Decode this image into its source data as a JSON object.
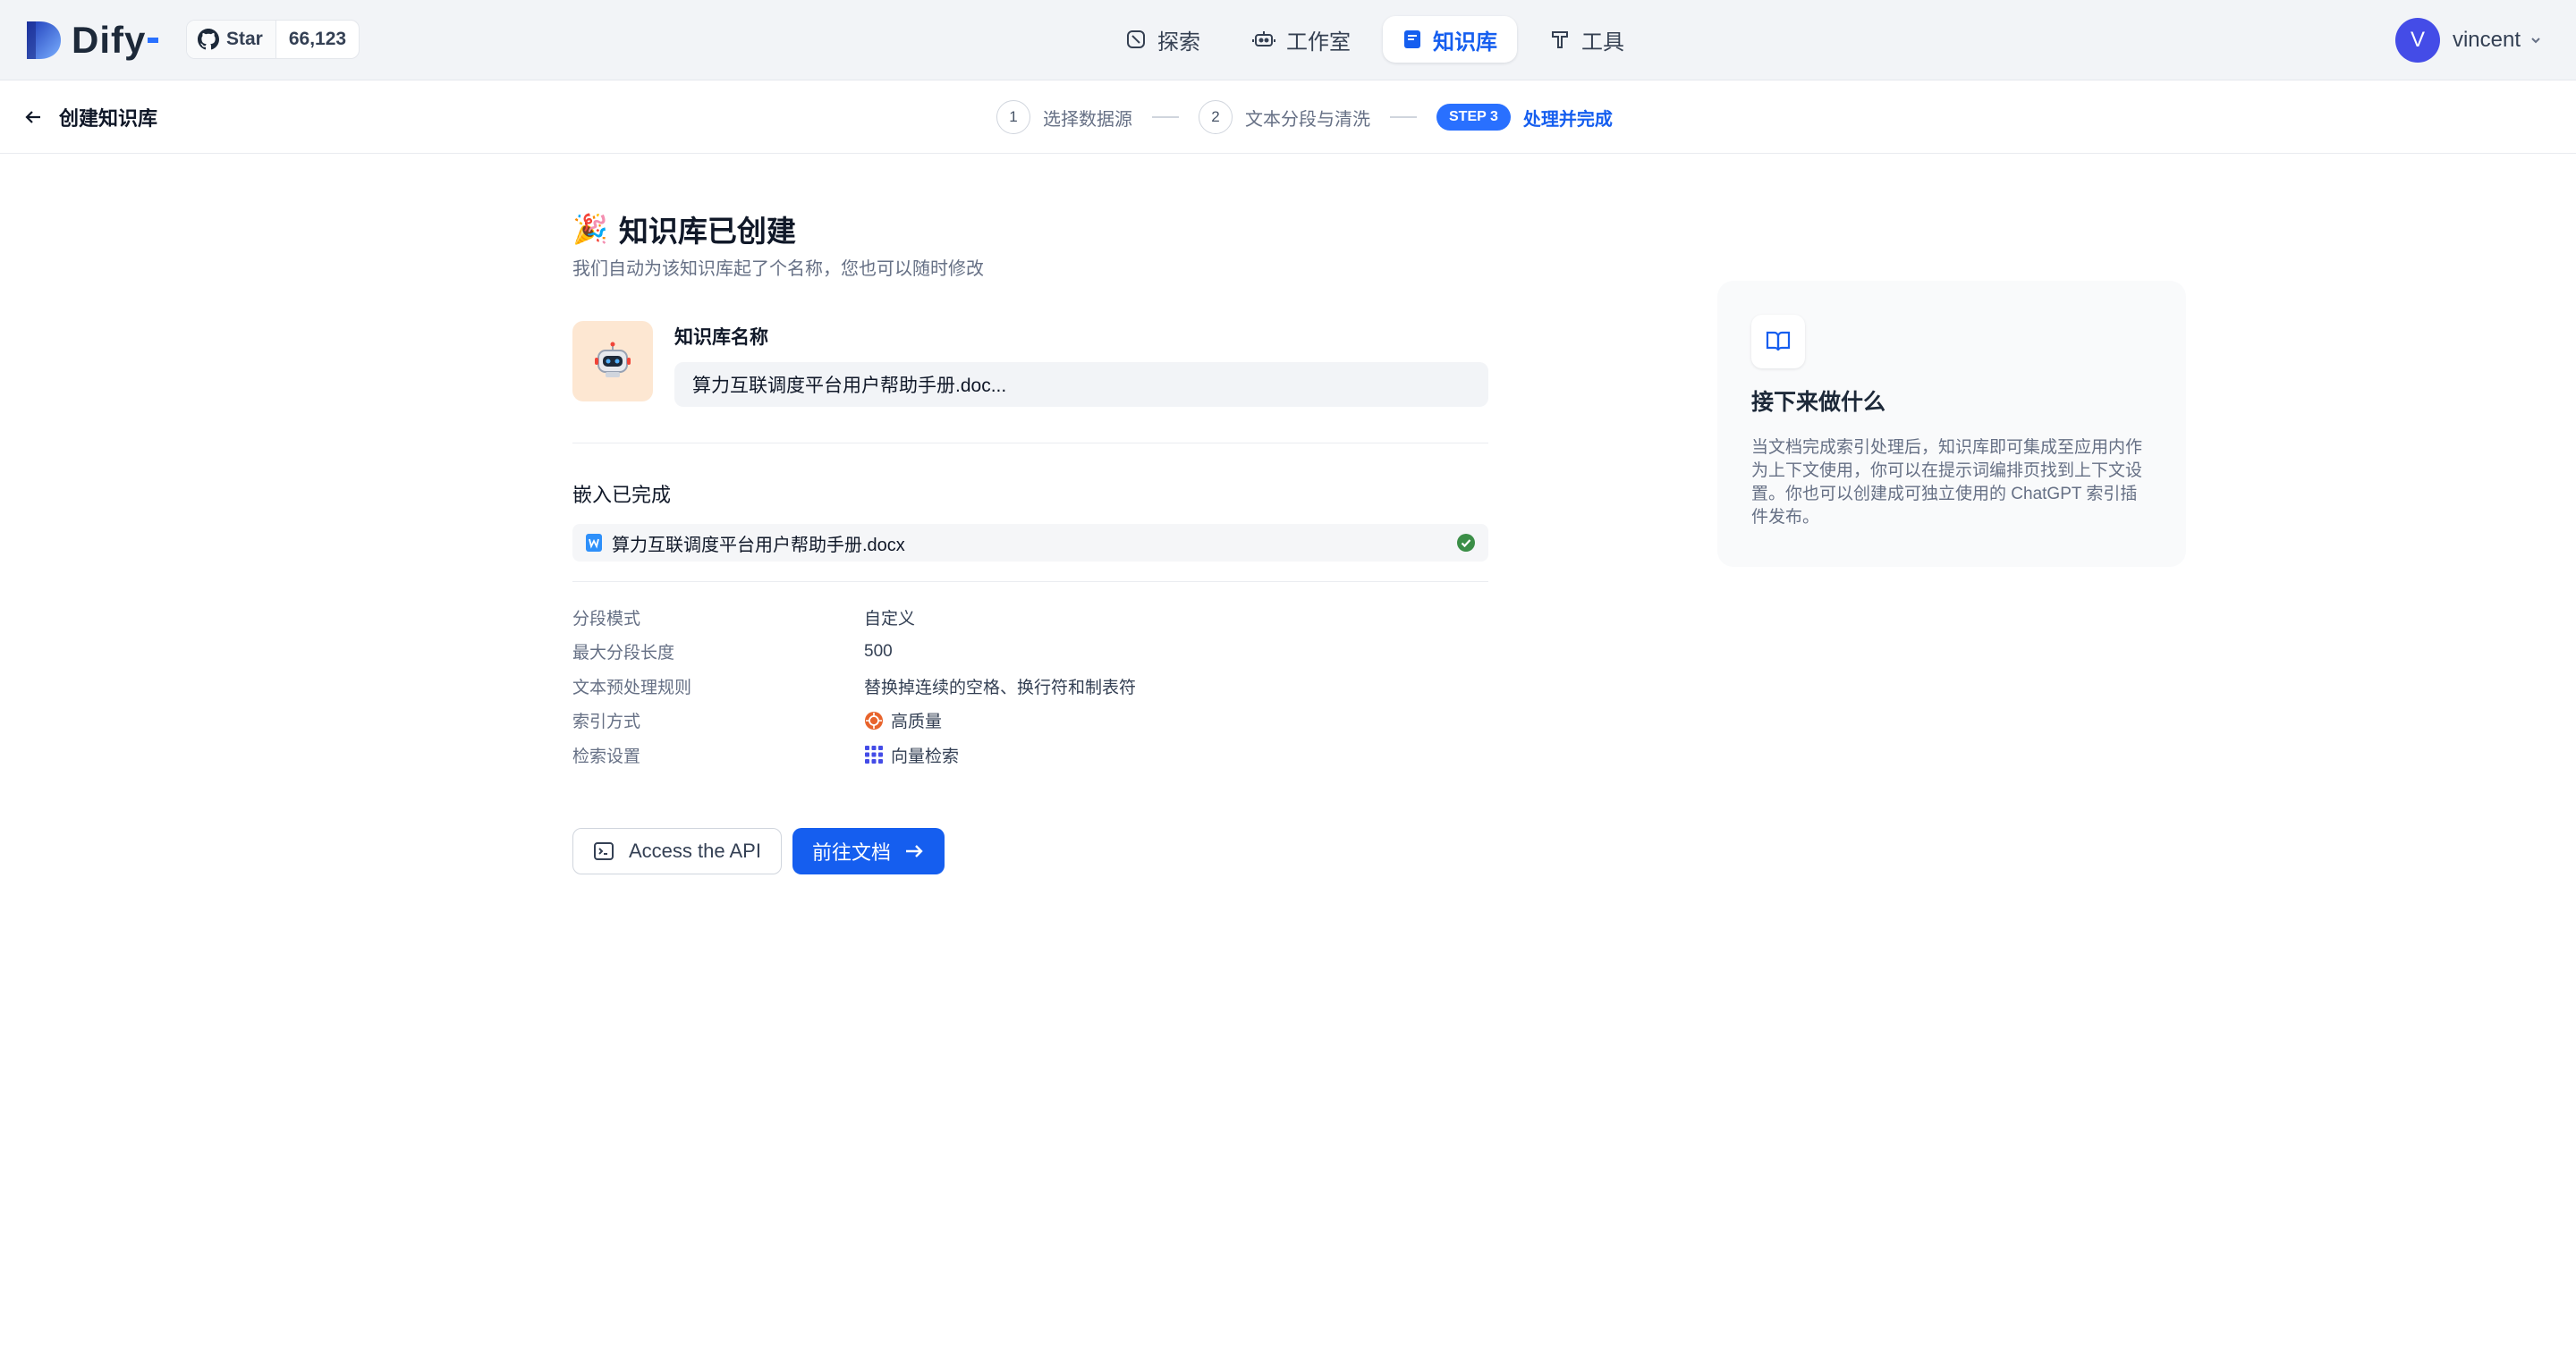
{
  "header": {
    "logo_text": "Dify",
    "github": {
      "label": "Star",
      "count": "66,123"
    },
    "nav": [
      {
        "label": "探索",
        "icon": "compass-icon",
        "active": false
      },
      {
        "label": "工作室",
        "icon": "robot-icon",
        "active": false
      },
      {
        "label": "知识库",
        "icon": "book-icon",
        "active": true
      },
      {
        "label": "工具",
        "icon": "hammer-icon",
        "active": false
      }
    ],
    "user": {
      "initial": "V",
      "name": "vincent"
    }
  },
  "subheader": {
    "back_label": "创建知识库",
    "steps": [
      {
        "num": "1",
        "label": "选择数据源"
      },
      {
        "num": "2",
        "label": "文本分段与清洗"
      },
      {
        "num": "STEP 3",
        "label": "处理并完成"
      }
    ]
  },
  "main": {
    "title": "知识库已创建",
    "subtitle": "我们自动为该知识库起了个名称，您也可以随时修改",
    "name_label": "知识库名称",
    "name_value": "算力互联调度平台用户帮助手册.doc...",
    "embed_title": "嵌入已完成",
    "document": {
      "name": "算力互联调度平台用户帮助手册.docx",
      "status": "completed"
    },
    "info": [
      {
        "key": "分段模式",
        "value": "自定义"
      },
      {
        "key": "最大分段长度",
        "value": "500"
      },
      {
        "key": "文本预处理规则",
        "value": "替换掉连续的空格、换行符和制表符"
      },
      {
        "key": "索引方式",
        "value": "高质量",
        "icon": "quality-icon"
      },
      {
        "key": "检索设置",
        "value": "向量检索",
        "icon": "vector-icon"
      }
    ],
    "buttons": {
      "api": "Access the API",
      "docs": "前往文档"
    }
  },
  "side": {
    "title": "接下来做什么",
    "text": "当文档完成索引处理后，知识库即可集成至应用内作为上下文使用，你可以在提示词编排页找到上下文设置。你也可以创建成可独立使用的 ChatGPT 索引插件发布。"
  },
  "colors": {
    "primary": "#155eef",
    "header_bg": "#f2f4f7",
    "success": "#12b76a",
    "avatar": "#444ce7"
  }
}
